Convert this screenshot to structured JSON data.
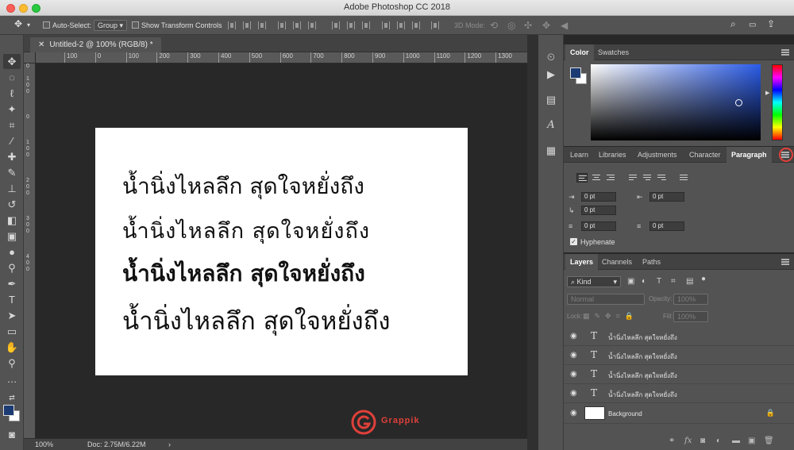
{
  "window": {
    "app_title": "Adobe Photoshop CC 2018"
  },
  "options_bar": {
    "auto_select_label": "Auto-Select:",
    "auto_select_value": "Group",
    "show_transform_label": "Show Transform Controls",
    "mode_3d_label": "3D Mode:"
  },
  "document": {
    "tab_title": "Untitled-2 @ 100% (RGB/8) *",
    "zoom": "100%",
    "doc_info": "Doc: 2.75M/6.22M"
  },
  "ruler": {
    "h_ticks": [
      "100",
      "0",
      "100",
      "200",
      "300",
      "400",
      "500",
      "600",
      "700",
      "800",
      "900",
      "1000",
      "1100",
      "1200",
      "1300"
    ]
  },
  "canvas": {
    "lines": [
      "น้ำนิ่งไหลลึก สุดใจหยั่งถึง",
      "น้ำนิ่งไหลลึก สุดใจหยั่งถึง",
      "น้ำนิ่งไหลลึก สุดใจหยั่งถึง",
      "น้ำนิ่งไหลลึก สุดใจหยั่งถึง"
    ]
  },
  "color_panel": {
    "tabs": [
      "Color",
      "Swatches"
    ],
    "foreground": "#1c3b72",
    "background": "#ffffff"
  },
  "paragraph_panel": {
    "tabs": [
      "Learn",
      "Libraries",
      "Adjustments",
      "Character",
      "Paragraph"
    ],
    "indent_left": "0 pt",
    "indent_right": "0 pt",
    "first_line": "0 pt",
    "space_before": "0 pt",
    "space_after": "0 pt",
    "hyphenate_label": "Hyphenate"
  },
  "layers_panel": {
    "tabs": [
      "Layers",
      "Channels",
      "Paths"
    ],
    "filter_kind": "Kind",
    "blend_mode": "Normal",
    "opacity_label": "Opacity:",
    "opacity_value": "100%",
    "lock_label": "Lock:",
    "fill_label": "Fill:",
    "fill_value": "100%",
    "layers": [
      {
        "name": "น้ำนิ่งไหลลึก สุดใจหยั่งถึง",
        "type": "text"
      },
      {
        "name": "น้ำนิ่งไหลลึก สุดใจหยั่งถึง",
        "type": "text"
      },
      {
        "name": "น้ำนิ่งไหลลึก สุดใจหยั่งถึง",
        "type": "text"
      },
      {
        "name": "น้ำนิ่งไหลลึก สุดใจหยั่งถึง",
        "type": "text"
      },
      {
        "name": "Background",
        "type": "background"
      }
    ]
  },
  "watermark": {
    "brand": "Grappik",
    "color": "#e0403a"
  },
  "accent_colors": {
    "highlight_circle": "#e0403a"
  }
}
